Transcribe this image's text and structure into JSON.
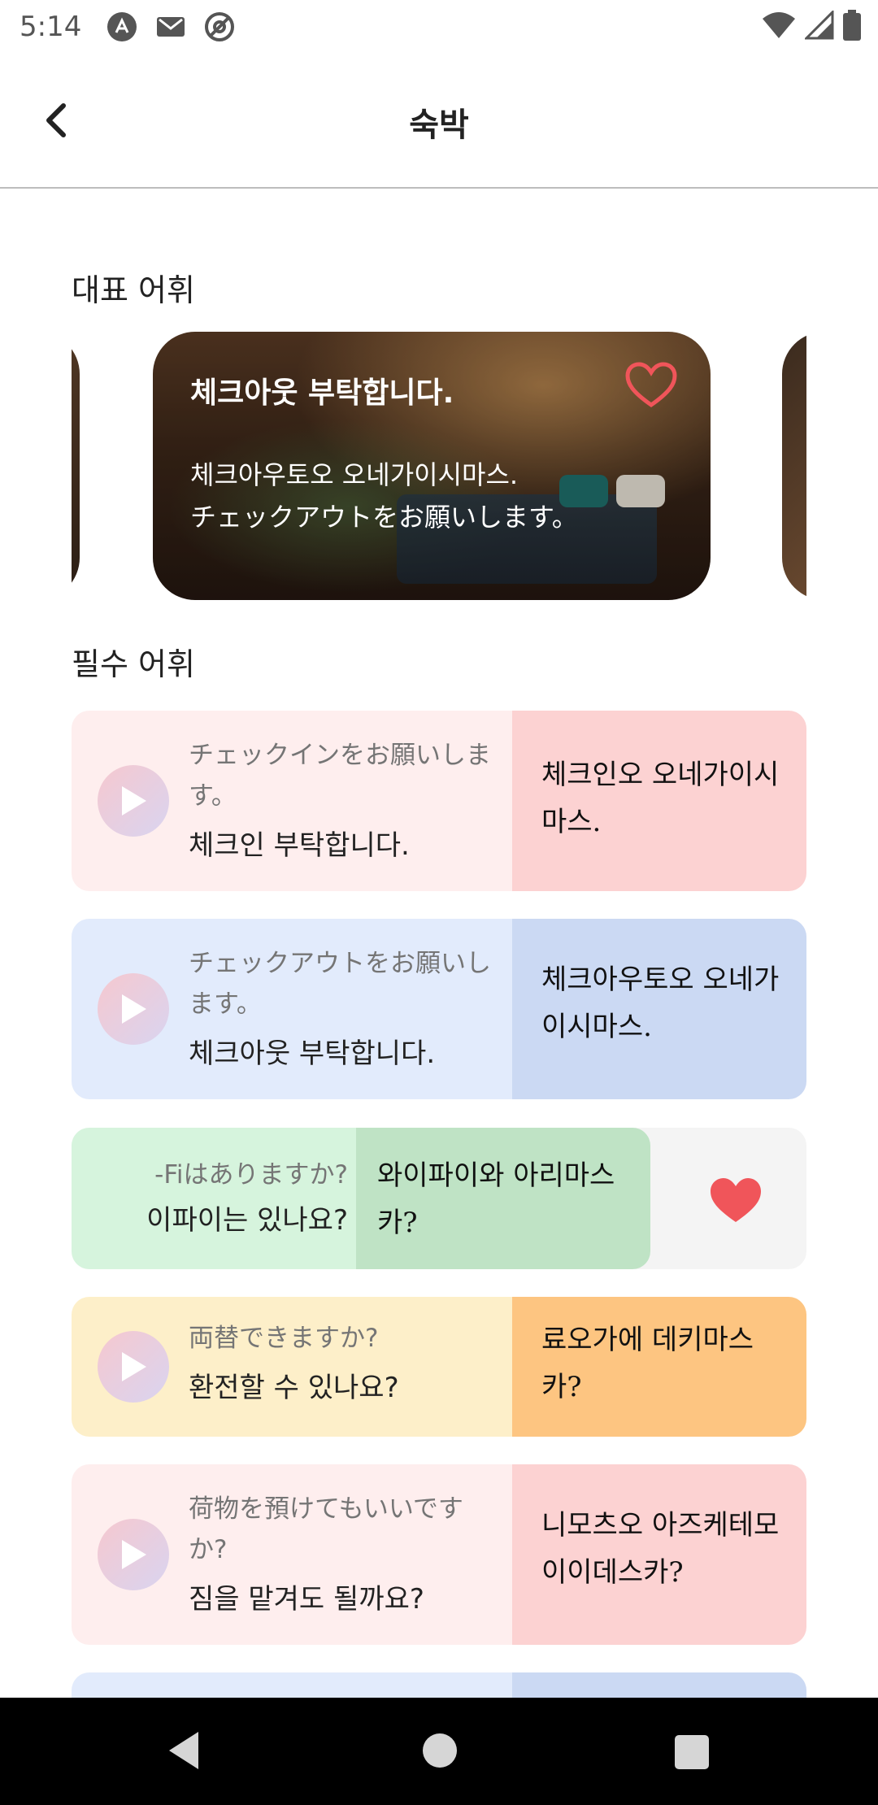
{
  "status_bar": {
    "time": "5:14"
  },
  "header": {
    "title": "숙박"
  },
  "featured": {
    "section_title": "대표 어휘",
    "card": {
      "title": "체크아웃 부탁합니다.",
      "reading": "체크아우토오 오네가이시마스.",
      "japanese": "チェックアウトをお願いします。"
    }
  },
  "essential": {
    "section_title": "필수 어휘",
    "items": [
      {
        "japanese": "チェックインをお願いします。",
        "korean": "체크인 부탁합니다.",
        "reading": "체크인오 오네가이시마스."
      },
      {
        "japanese": "チェックアウトをお願いします。",
        "korean": "체크아웃 부탁합니다.",
        "reading": "체크아우토오 오네가이시마스."
      },
      {
        "japanese": "-Fiはありますか?",
        "korean": "이파이는 있나요?",
        "reading": "와이파이와 아리마스카?"
      },
      {
        "japanese": "両替できますか?",
        "korean": "환전할 수 있나요?",
        "reading": "료오가에 데키마스카?"
      },
      {
        "japanese": "荷物を預けてもいいですか?",
        "korean": "짐을 맡겨도 될까요?",
        "reading": "니모츠오 아즈케테모 이이데스카?"
      }
    ]
  },
  "colors": {
    "favorite": "#f0555a",
    "pink": "#fcd2d2",
    "blue": "#cbd9f3",
    "green": "#bfe3c5",
    "yellow": "#fdc581"
  }
}
